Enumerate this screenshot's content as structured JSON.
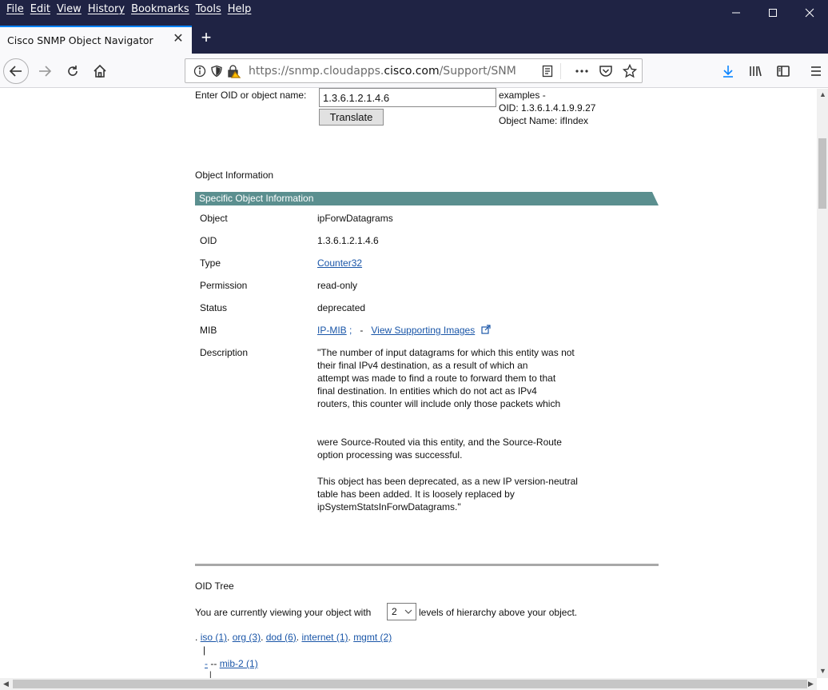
{
  "menu": [
    "File",
    "Edit",
    "View",
    "History",
    "Bookmarks",
    "Tools",
    "Help"
  ],
  "tab": {
    "title": "Cisco SNMP Object Navigator",
    "close": "✕",
    "new_tab": "+"
  },
  "url": {
    "prefix": "https://snmp.cloudapps.",
    "domain": "cisco.com",
    "suffix": "/Support/SNMP"
  },
  "translate_form": {
    "label": "Enter OID or object name:",
    "input_value": "1.3.6.1.2.1.4.6",
    "button": "Translate",
    "examples_heading": "examples -",
    "example_oid": "OID: 1.3.6.1.4.1.9.9.27",
    "example_name": "Object Name: ifIndex"
  },
  "object_info": {
    "heading": "Object Information",
    "banner": "Specific Object Information",
    "rows": {
      "object": {
        "label": "Object",
        "value": "ipForwDatagrams"
      },
      "oid": {
        "label": "OID",
        "value": "1.3.6.1.2.1.4.6"
      },
      "type": {
        "label": "Type",
        "value": "Counter32"
      },
      "permission": {
        "label": "Permission",
        "value": "read-only"
      },
      "status": {
        "label": "Status",
        "value": "deprecated"
      },
      "mib": {
        "label": "MIB",
        "mib_link": "IP-MIB",
        "mib_suffix": " ;",
        "separator": "-",
        "images_link": "View Supporting Images"
      },
      "description": {
        "label": "Description",
        "para1": [
          "\"The number of input datagrams for which this entity was not",
          "their final IPv4 destination, as a result of which an",
          "attempt was made to find a route to forward them to that",
          "final destination. In entities which do not act as IPv4",
          "routers, this counter will include only those packets which"
        ],
        "para2": [
          "were Source-Routed via this entity, and the Source-Route",
          "option processing was successful."
        ],
        "para3": [
          "This object has been deprecated, as a new IP version-neutral",
          "table has been added. It is loosely replaced by",
          "ipSystemStatsInForwDatagrams.\""
        ]
      }
    }
  },
  "oid_tree": {
    "heading": "OID Tree",
    "levels_before": "You are currently viewing your object with",
    "levels_value": "2",
    "levels_after": "levels of hierarchy above your object.",
    "path_lead": ".",
    "path": [
      "iso (1)",
      "org (3)",
      "dod (6)",
      "internet (1)",
      "mgmt (2)"
    ],
    "path_sep": ".",
    "pipe": "|",
    "child_dash_link": "-",
    "child_connector": "--",
    "child_link": "mib-2 (1)"
  }
}
